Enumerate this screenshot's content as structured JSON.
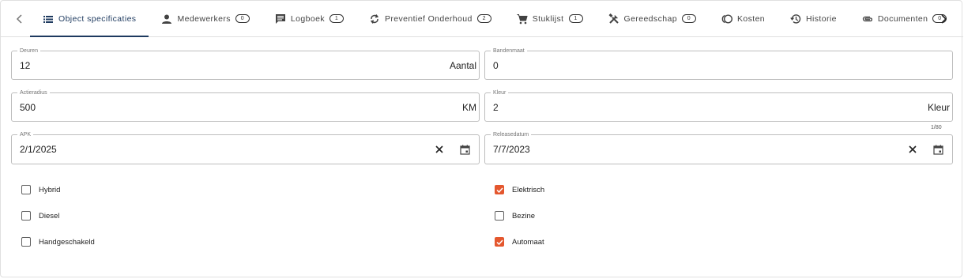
{
  "tabs": [
    {
      "label": "Object specificaties",
      "icon": "list-icon",
      "badge": null,
      "active": true
    },
    {
      "label": "Medewerkers",
      "icon": "person-icon",
      "badge": "0"
    },
    {
      "label": "Logboek",
      "icon": "comment-icon",
      "badge": "1"
    },
    {
      "label": "Preventief Onderhoud",
      "icon": "sync-icon",
      "badge": "2"
    },
    {
      "label": "Stuklijst",
      "icon": "cart-icon",
      "badge": "1"
    },
    {
      "label": "Gereedschap",
      "icon": "tools-icon",
      "badge": "0"
    },
    {
      "label": "Kosten",
      "icon": "coins-icon",
      "badge": null
    },
    {
      "label": "Historie",
      "icon": "history-icon",
      "badge": null
    },
    {
      "label": "Documenten",
      "icon": "paperclip-icon",
      "badge": "0"
    }
  ],
  "fields": {
    "deuren": {
      "label": "Deuren",
      "value": "12",
      "unit": "Aantal"
    },
    "bandenmaat": {
      "label": "Bandenmaat",
      "value": "0"
    },
    "actieradius": {
      "label": "Actieradius",
      "value": "500",
      "unit": "KM"
    },
    "kleur": {
      "label": "Kleur",
      "value": "2",
      "unit": "Kleur"
    },
    "apk": {
      "label": "APK",
      "value": "2/1/2025"
    },
    "releasedatum": {
      "label": "Releasedatum",
      "value": "7/7/2023",
      "counter": "1/80"
    }
  },
  "checkboxes": {
    "hybrid": {
      "label": "Hybrid",
      "checked": false
    },
    "diesel": {
      "label": "Diesel",
      "checked": false
    },
    "handgeschakeld": {
      "label": "Handgeschakeld",
      "checked": false
    },
    "elektrisch": {
      "label": "Elektrisch",
      "checked": true
    },
    "bezine": {
      "label": "Bezine",
      "checked": false
    },
    "automaat": {
      "label": "Automaat",
      "checked": true
    }
  },
  "colors": {
    "accent": "#e4572e",
    "tab_active": "#1e3a5f"
  }
}
